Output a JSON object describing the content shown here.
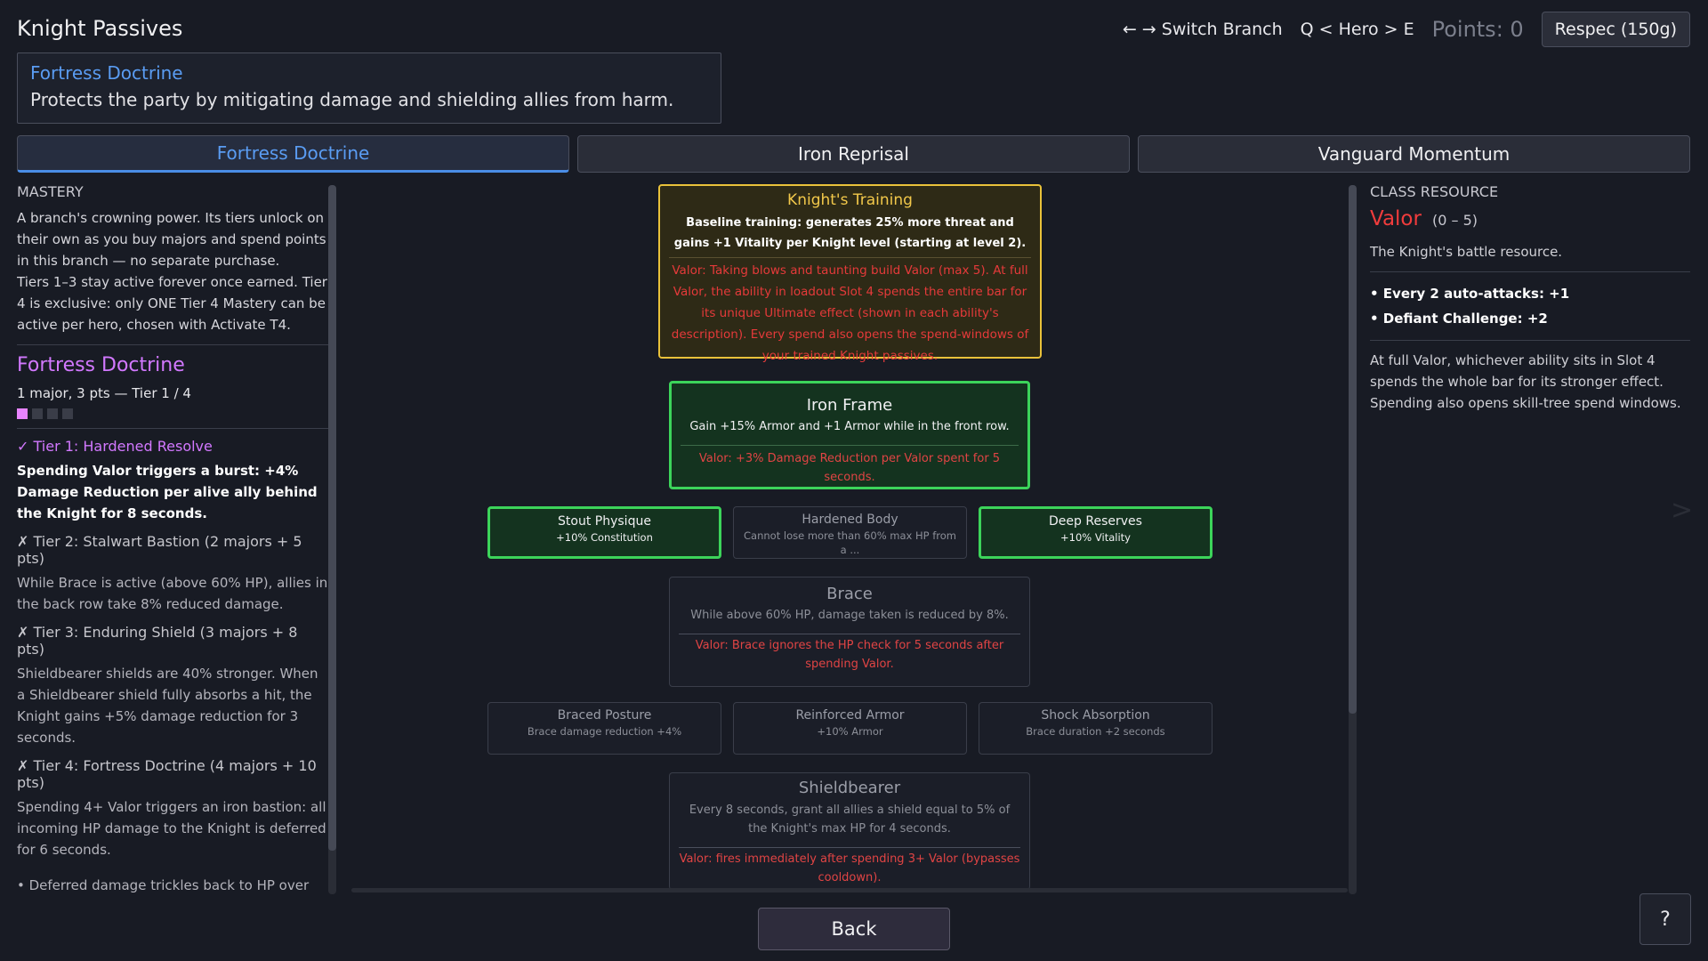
{
  "header": {
    "title": "Knight Passives",
    "switch_branch_hint": "← → Switch Branch",
    "hero_hint": "Q < Hero > E",
    "points": "Points: 0",
    "respec_label": "Respec (150g)"
  },
  "branch_info": {
    "title": "Fortress Doctrine",
    "description": "Protects the party by mitigating damage and shielding allies from harm."
  },
  "tabs": [
    {
      "label": "Fortress Doctrine",
      "active": true
    },
    {
      "label": "Iron Reprisal",
      "active": false
    },
    {
      "label": "Vanguard Momentum",
      "active": false
    }
  ],
  "mastery": {
    "heading": "MASTERY",
    "intro": "A branch's crowning power. Its tiers unlock on their own as you buy majors and spend points in this branch — no separate purchase.",
    "intro2": "Tiers 1–3 stay active forever once earned. Tier 4 is exclusive: only ONE Tier 4 Mastery can be active per hero, chosen with Activate T4.",
    "name": "Fortress Doctrine",
    "progress": "1 major, 3 pts — Tier 1 / 4",
    "tiers_unlocked": 1,
    "tiers_total": 4,
    "tiers": [
      {
        "heading": "✓ Tier 1: Hardened Resolve",
        "description": "Spending Valor triggers a burst: +4% Damage Reduction per alive ally behind the Knight for 8 seconds.",
        "unlocked": true
      },
      {
        "heading": "✗ Tier 2: Stalwart Bastion  (2 majors + 5 pts)",
        "description": "While Brace is active (above 60% HP), allies in the back row take 8% reduced damage.",
        "unlocked": false
      },
      {
        "heading": "✗ Tier 3: Enduring Shield  (3 majors + 8 pts)",
        "description": "Shieldbearer shields are 40% stronger. When a Shieldbearer shield fully absorbs a hit, the Knight gains +5% damage reduction for 3 seconds.",
        "unlocked": false
      },
      {
        "heading": "✗ Tier 4: Fortress Doctrine  (4 majors + 10 pts)",
        "description": "Spending 4+ Valor triggers an iron bastion: all incoming HP damage to the Knight is deferred for 6 seconds.",
        "unlocked": false
      }
    ],
    "note": "• Deferred damage trickles back to HP over the duration of the window."
  },
  "tree": {
    "knights_training": {
      "title": "Knight's Training",
      "description": "Baseline training: generates 25% more threat and gains +1 Vitality per Knight level (starting at level 2).",
      "valor": "Valor: Taking blows and taunting build Valor (max 5). At full Valor, the ability in loadout Slot 4 spends the entire bar for its unique Ultimate effect (shown in each ability's description). Every spend also opens the spend-windows of your trained Knight passives."
    },
    "iron_frame": {
      "title": "Iron Frame",
      "description": "Gain +15% Armor and +1 Armor while in the front row.",
      "valor": "Valor: +3% Damage Reduction per Valor spent for 5 seconds."
    },
    "row1": [
      {
        "title": "Stout Physique",
        "description": "+10% Constitution",
        "learned": true
      },
      {
        "title": "Hardened Body",
        "description": "Cannot lose more than 60% max HP from a ...",
        "learned": false
      },
      {
        "title": "Deep Reserves",
        "description": "+10% Vitality",
        "learned": true
      }
    ],
    "brace": {
      "title": "Brace",
      "description": "While above 60% HP, damage taken is reduced by 8%.",
      "valor": "Valor: Brace ignores the HP check for 5 seconds after spending Valor."
    },
    "row2": [
      {
        "title": "Braced Posture",
        "description": "Brace damage reduction +4%",
        "learned": false
      },
      {
        "title": "Reinforced Armor",
        "description": "+10% Armor",
        "learned": false
      },
      {
        "title": "Shock Absorption",
        "description": "Brace duration +2 seconds",
        "learned": false
      }
    ],
    "shieldbearer": {
      "title": "Shieldbearer",
      "description": "Every 8 seconds, grant all allies a shield equal to 5% of the Knight's max HP for 4 seconds.",
      "valor": "Valor: fires immediately after spending 3+ Valor (bypasses cooldown)."
    }
  },
  "resource": {
    "heading": "CLASS RESOURCE",
    "name": "Valor",
    "range": "(0 – 5)",
    "description": "The Knight's battle resource.",
    "gains": [
      "• Every 2 auto-attacks: +1",
      "• Defiant Challenge: +2"
    ],
    "full_text": "At full Valor, whichever ability sits in Slot 4 spends the whole bar for its stronger effect.",
    "full_text2": "Spending also opens skill-tree spend windows."
  },
  "footer": {
    "back_label": "Back",
    "help_label": "?",
    "next_arrow": ">"
  },
  "colors": {
    "accent_blue": "#5a9cf2",
    "mastery_purple": "#d278ff",
    "valor_red": "#f03c3c",
    "learned_green": "#3cd45a",
    "training_gold": "#e9c23a"
  }
}
